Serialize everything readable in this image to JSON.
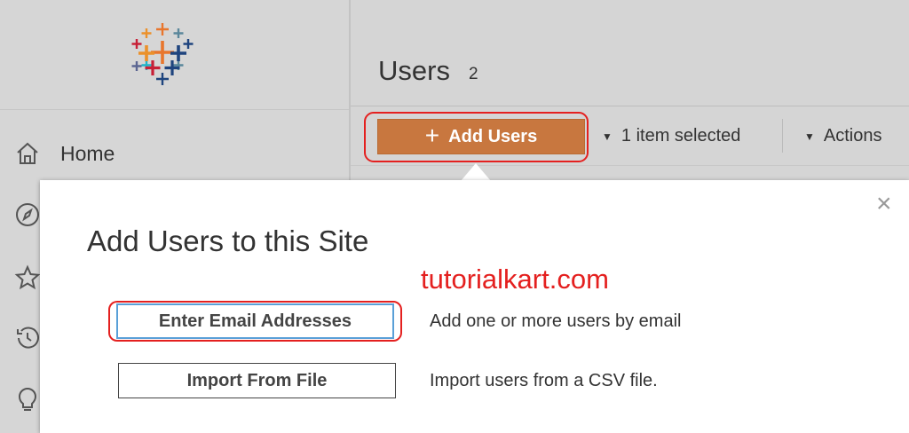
{
  "sidebar": {
    "logo": "tableau-logo",
    "items": [
      {
        "label": "Home",
        "icon": "home-icon"
      },
      {
        "label": "",
        "icon": "compass-icon"
      },
      {
        "label": "",
        "icon": "star-icon"
      },
      {
        "label": "",
        "icon": "history-icon"
      },
      {
        "label": "",
        "icon": "lightbulb-icon"
      }
    ]
  },
  "header": {
    "title": "Users",
    "count": "2"
  },
  "toolbar": {
    "add_label": "Add Users",
    "selection": "1 item selected",
    "actions": "Actions"
  },
  "dialog": {
    "title": "Add Users to this Site",
    "watermark": "tutorialkart.com",
    "close": "×",
    "options": [
      {
        "button": "Enter Email Addresses",
        "description": "Add one or more users by email"
      },
      {
        "button": "Import From File",
        "description": "Import users from a CSV file."
      }
    ]
  },
  "colors": {
    "accent": "#c8773f",
    "highlight": "#e4201f",
    "focus": "#5aa0d8"
  }
}
